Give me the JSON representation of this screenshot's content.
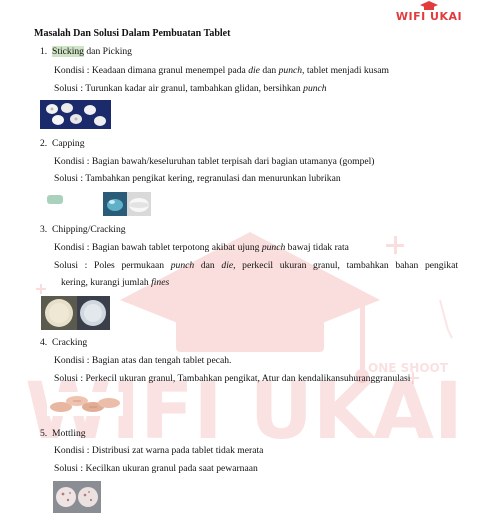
{
  "logo": {
    "text": "WIFI UKAI"
  },
  "watermark": {
    "text": "WIFI UKAI",
    "sub": "ONE SHOOT"
  },
  "title": "Masalah Dan Solusi Dalam Pembuatan Tablet",
  "sections": [
    {
      "num": "1.",
      "heading_hl": "Sticking",
      "heading_rest": " dan Picking",
      "kondisi_a": "Kondisi : Keadaan dimana granul menempel pada ",
      "kondisi_i1": "die",
      "kondisi_b": " dan ",
      "kondisi_i2": "punch,",
      "kondisi_c": " tablet menjadi kusam",
      "solusi_a": "Solusi : Turunkan kadar air granul, tambahkan glidan, bersihkan ",
      "solusi_i": "punch"
    },
    {
      "num": "2.",
      "heading": "Capping",
      "kondisi": "Kondisi : Bagian bawah/keseluruhan tablet terpisah dari bagian utamanya (gompel)",
      "solusi": "Solusi : Tambahkan pengikat kering, regranulasi dan menurunkan lubrikan"
    },
    {
      "num": "3.",
      "heading": "Chipping/Cracking",
      "kondisi_a": "Kondisi : Bagian bawah tablet terpotong akibat ujung ",
      "kondisi_i": "punch",
      "kondisi_b": " bawaj tidak rata",
      "solusi_a": "Solusi : Poles permukaan ",
      "solusi_i1": "punch",
      "solusi_b": " dan ",
      "solusi_i2": "die,",
      "solusi_c": " perkecil ukuran granul, tambahkan bahan pengikat",
      "solusi_line2_a": "kering, kurangi jumlah ",
      "solusi_line2_i": "fines"
    },
    {
      "num": "4.",
      "heading": "Cracking",
      "kondisi": "Kondisi : Bagian atas dan tengah tablet pecah.",
      "solusi": "Solusi : Perkecil ukuran granul, Tambahkan pengikat, Atur dan kendalikansuhuranggranulasi"
    },
    {
      "num": "5.",
      "heading": "Mottling",
      "kondisi": "Kondisi : Distribusi zat warna pada tablet tidak merata",
      "solusi": "Solusi : Kecilkan ukuran granul pada saat pewarnaan"
    }
  ],
  "colors": {
    "watermark": "#e23b3b",
    "highlight": "#cfe3c5",
    "text": "#111111"
  }
}
